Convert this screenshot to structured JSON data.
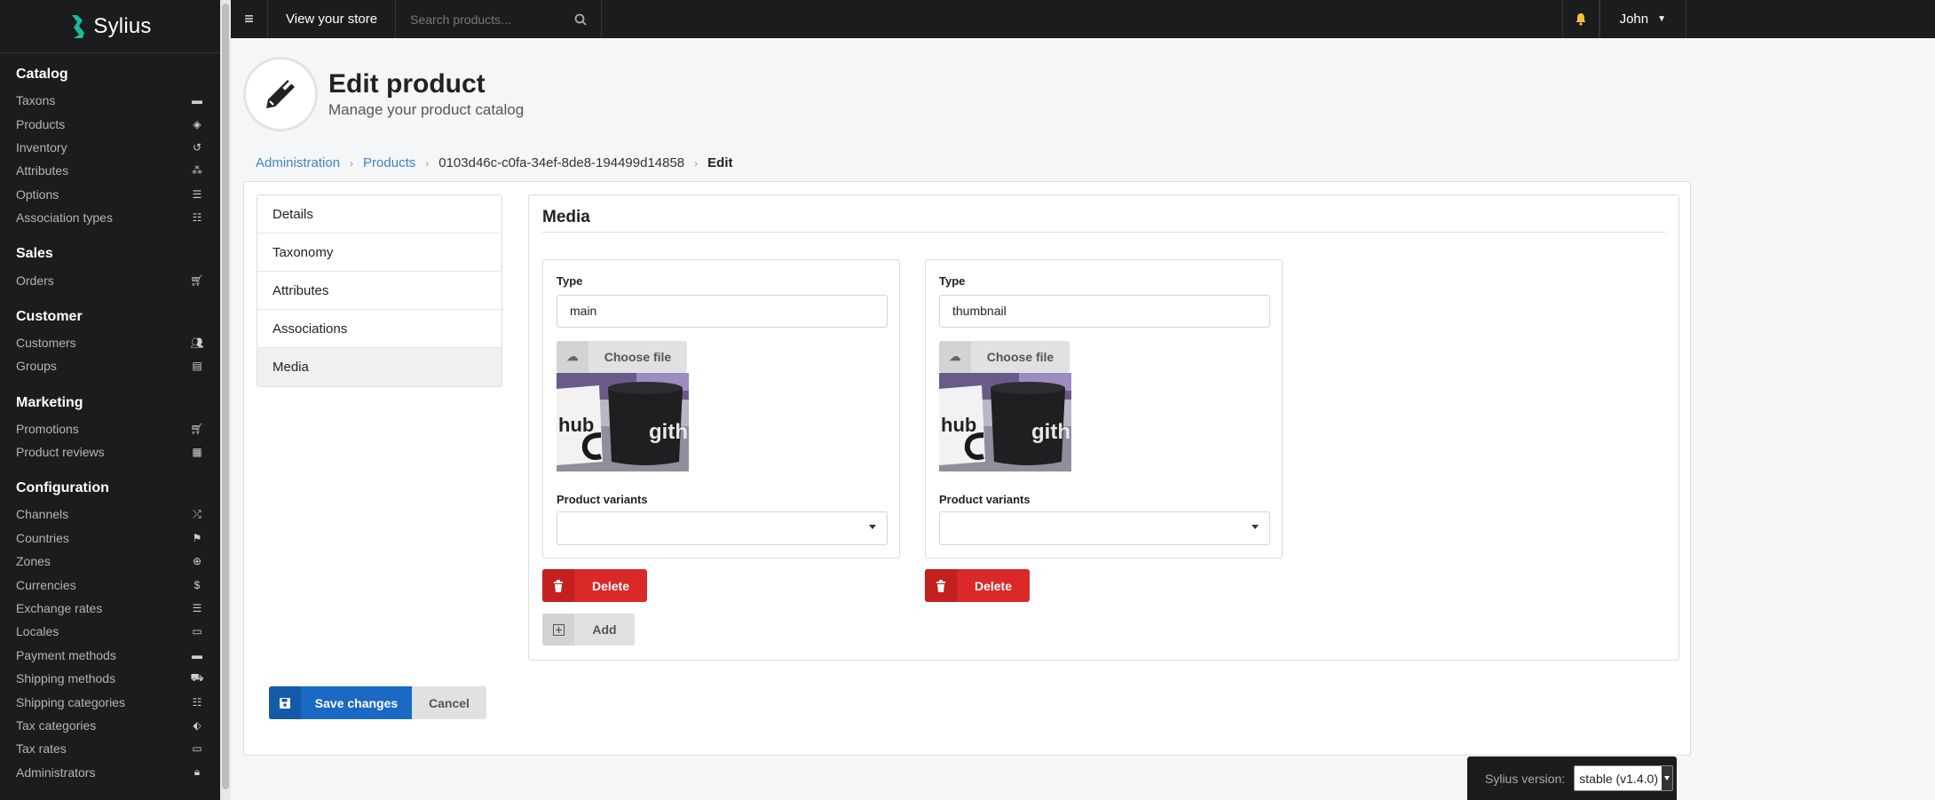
{
  "app": {
    "name": "Sylius"
  },
  "sidebar": {
    "sections": [
      {
        "title": "Catalog",
        "items": [
          {
            "label": "Taxons",
            "icon": "folder-icon"
          },
          {
            "label": "Products",
            "icon": "cube-icon"
          },
          {
            "label": "Inventory",
            "icon": "history-icon"
          },
          {
            "label": "Attributes",
            "icon": "cubes-icon"
          },
          {
            "label": "Options",
            "icon": "sliders-icon"
          },
          {
            "label": "Association types",
            "icon": "list-icon"
          }
        ]
      },
      {
        "title": "Sales",
        "items": [
          {
            "label": "Orders",
            "icon": "cart-icon"
          }
        ]
      },
      {
        "title": "Customer",
        "items": [
          {
            "label": "Customers",
            "icon": "users-icon"
          },
          {
            "label": "Groups",
            "icon": "archive-icon"
          }
        ]
      },
      {
        "title": "Marketing",
        "items": [
          {
            "label": "Promotions",
            "icon": "cart-plus-icon"
          },
          {
            "label": "Product reviews",
            "icon": "newspaper-icon"
          }
        ]
      },
      {
        "title": "Configuration",
        "items": [
          {
            "label": "Channels",
            "icon": "random-icon"
          },
          {
            "label": "Countries",
            "icon": "flag-icon"
          },
          {
            "label": "Zones",
            "icon": "globe-icon"
          },
          {
            "label": "Currencies",
            "icon": "dollar-icon"
          },
          {
            "label": "Exchange rates",
            "icon": "sliders-icon"
          },
          {
            "label": "Locales",
            "icon": "language-icon"
          },
          {
            "label": "Payment methods",
            "icon": "credit-card-icon"
          },
          {
            "label": "Shipping methods",
            "icon": "truck-icon"
          },
          {
            "label": "Shipping categories",
            "icon": "list-icon"
          },
          {
            "label": "Tax categories",
            "icon": "tags-icon"
          },
          {
            "label": "Tax rates",
            "icon": "money-icon"
          },
          {
            "label": "Administrators",
            "icon": "lock-icon"
          }
        ]
      }
    ]
  },
  "topbar": {
    "view_store": "View your store",
    "search_placeholder": "Search products...",
    "user_name": "John"
  },
  "header": {
    "title": "Edit product",
    "subtitle": "Manage your product catalog"
  },
  "breadcrumb": {
    "administration": "Administration",
    "products": "Products",
    "product_id": "0103d46c-c0fa-34ef-8de8-194499d14858",
    "current": "Edit"
  },
  "tabs": [
    "Details",
    "Taxonomy",
    "Attributes",
    "Associations",
    "Media"
  ],
  "active_tab": "Media",
  "media": {
    "title": "Media",
    "images": [
      {
        "type_label": "Type",
        "type_value": "main",
        "choose_file": "Choose file",
        "variants_label": "Product variants",
        "delete_label": "Delete"
      },
      {
        "type_label": "Type",
        "type_value": "thumbnail",
        "choose_file": "Choose file",
        "variants_label": "Product variants",
        "delete_label": "Delete"
      }
    ],
    "add_label": "Add"
  },
  "actions": {
    "save_label": "Save changes",
    "cancel_label": "Cancel"
  },
  "version": {
    "label": "Sylius version:",
    "value": "stable (v1.4.0)"
  },
  "colors": {
    "sidebar_bg": "#1b1c1d",
    "accent_green": "#1abb9c",
    "primary_blue": "#1a69c4",
    "danger_red": "#db2828",
    "link": "#4183c4"
  }
}
